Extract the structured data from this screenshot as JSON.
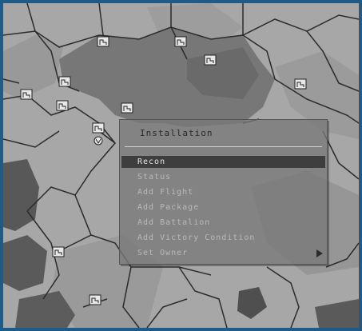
{
  "colors": {
    "frame": "#1f5b86",
    "terrain_light": "#a9a9a9",
    "terrain_mid": "#8f8f8f",
    "region_dark": "#6f6f6f",
    "water": "#4d4d4d",
    "borders": "#2b2b2b"
  },
  "map": {
    "installation_icon": "installation-marker-icon",
    "selected_icon": "selected-installation-icon"
  },
  "context_menu": {
    "title": "Installation",
    "items": [
      {
        "label": "Recon",
        "selected": true
      },
      {
        "label": "Status"
      },
      {
        "label": "Add Flight"
      },
      {
        "label": "Add Package"
      },
      {
        "label": "Add Battalion"
      },
      {
        "label": "Add Victory Condition"
      },
      {
        "label": "Set Owner",
        "submenu_icon": "chevron-right-icon"
      }
    ]
  }
}
